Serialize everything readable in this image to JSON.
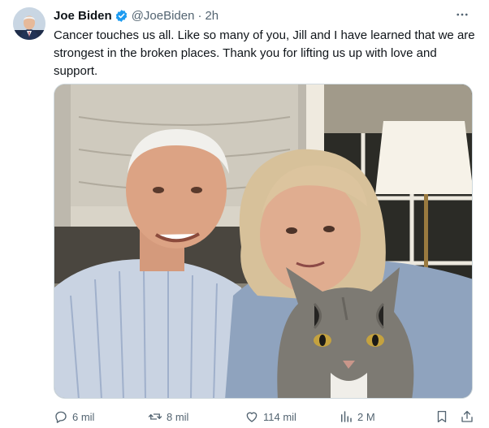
{
  "post": {
    "author_name": "Joe Biden",
    "handle": "@JoeBiden",
    "separator": "·",
    "time": "2h",
    "verified": true,
    "text": "Cancer touches us all. Like so many of you, Jill and I have learned that we are strongest in the broken places. Thank you for lifting us up with love and support.",
    "more_icon": "more-horizontal-icon"
  },
  "actions": {
    "replies": "6 mil",
    "reposts": "8 mil",
    "likes": "114 mil",
    "views": "2 M"
  },
  "colors": {
    "verified": "#1d9bf0",
    "text": "#0f1419",
    "muted": "#536471"
  }
}
